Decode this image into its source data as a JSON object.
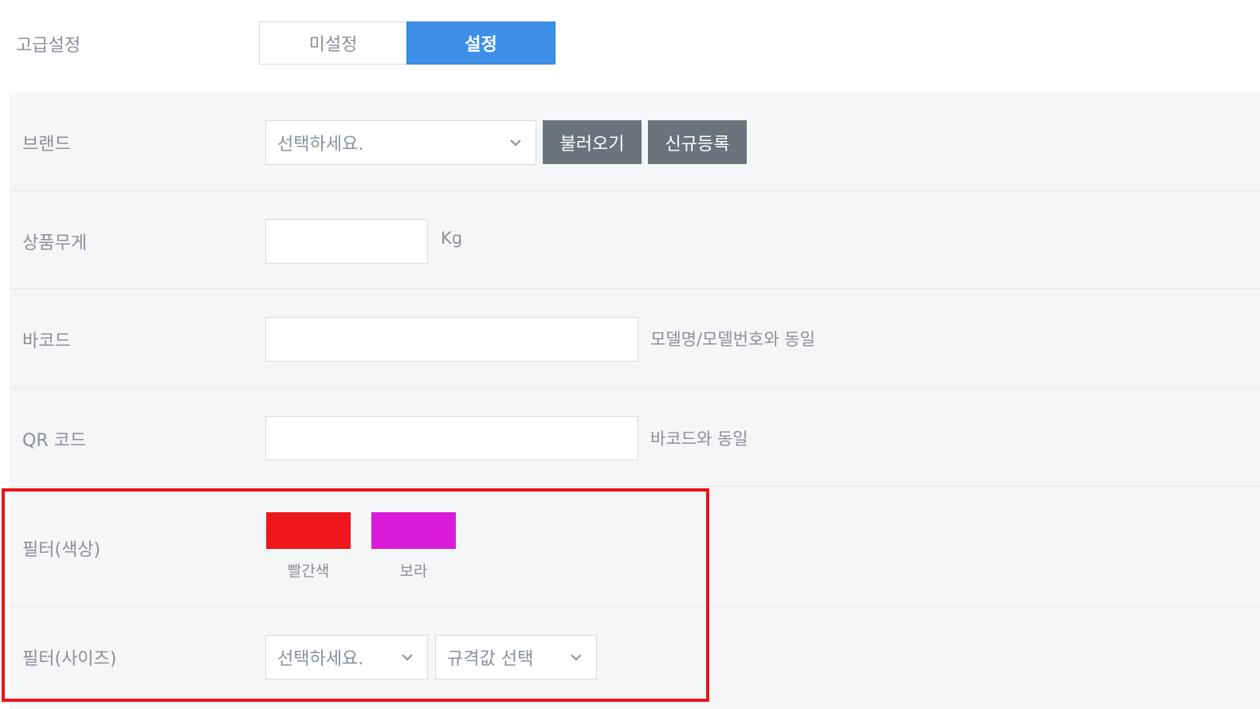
{
  "advanced": {
    "label": "고급설정",
    "option_off": "미설정",
    "option_on": "설정",
    "selected": "설정"
  },
  "brand": {
    "label": "브랜드",
    "select_value": "선택하세요.",
    "load_button": "불러오기",
    "register_button": "신규등록"
  },
  "weight": {
    "label": "상품무게",
    "value": "",
    "unit": "Kg"
  },
  "barcode": {
    "label": "바코드",
    "value": "",
    "hint": "모델명/모델번호와 동일"
  },
  "qrcode": {
    "label": "QR 코드",
    "value": "",
    "hint": "바코드와 동일"
  },
  "filter_color": {
    "label": "필터(색상)",
    "swatches": [
      {
        "name": "빨간색",
        "color": "#ec161b"
      },
      {
        "name": "보라",
        "color": "#d91ad9"
      }
    ]
  },
  "filter_size": {
    "label": "필터(사이즈)",
    "select_value": "선택하세요.",
    "spec_select_value": "규격값 선택"
  },
  "colors": {
    "accent": "#3d8fe8",
    "dark_button": "#6c737c",
    "highlight_border": "#e8141b"
  }
}
